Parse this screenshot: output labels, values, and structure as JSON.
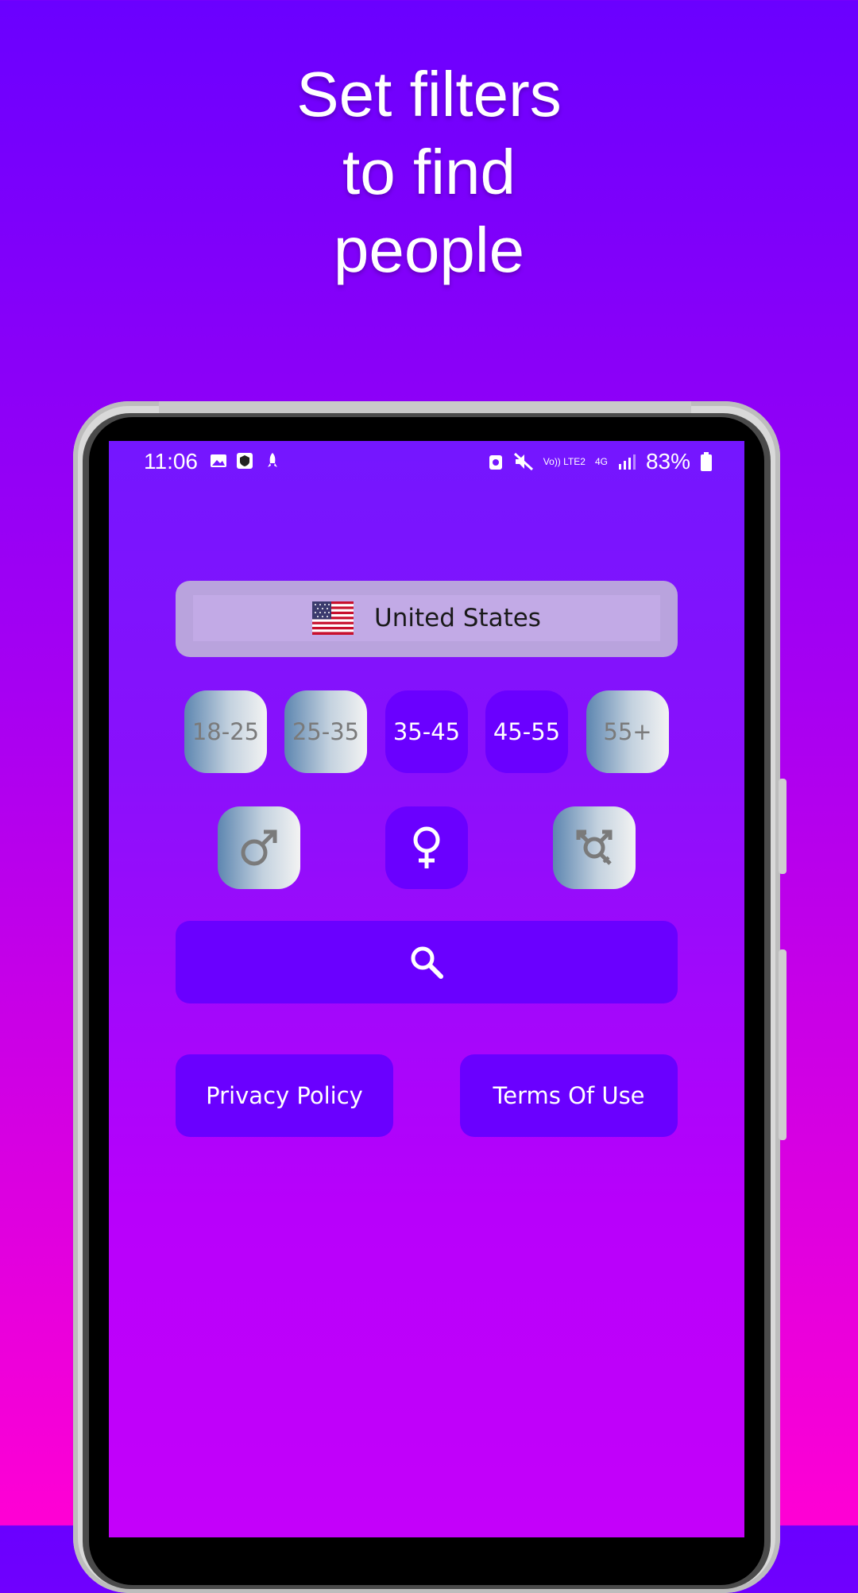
{
  "headline": {
    "line1": "Set filters",
    "line2": "to find",
    "line3": "people"
  },
  "status_bar": {
    "time": "11:06",
    "network": "Vo)) LTE2",
    "network_type": "4G",
    "battery": "83%"
  },
  "country": {
    "name": "United States",
    "flag_icon": "us-flag-icon"
  },
  "age_ranges": [
    {
      "label": "18-25",
      "selected": false
    },
    {
      "label": "25-35",
      "selected": false
    },
    {
      "label": "35-45",
      "selected": true
    },
    {
      "label": "45-55",
      "selected": true
    },
    {
      "label": "55+",
      "selected": false
    }
  ],
  "genders": [
    {
      "icon": "male-icon",
      "selected": false
    },
    {
      "icon": "female-icon",
      "selected": true
    },
    {
      "icon": "transgender-icon",
      "selected": false
    }
  ],
  "search": {
    "icon": "search-icon"
  },
  "links": {
    "privacy": "Privacy Policy",
    "terms": "Terms Of Use"
  },
  "colors": {
    "accent": "#6a00ff",
    "gradient_top": "#6a00ff",
    "gradient_bottom": "#ff00d4"
  }
}
